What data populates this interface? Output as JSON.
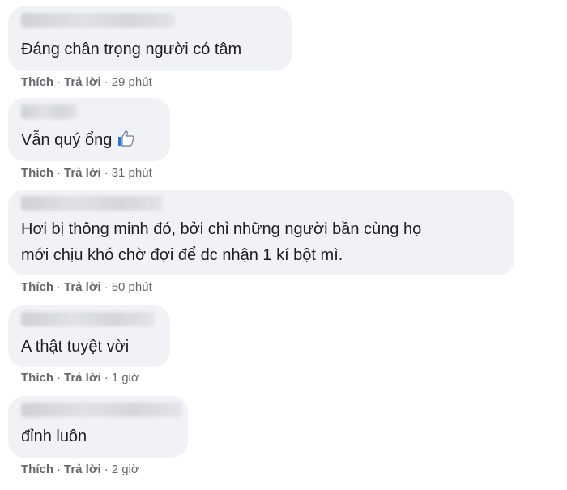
{
  "comments": [
    {
      "text": "Đáng chân trọng người có tâm",
      "like": "Thích",
      "reply": "Trả lời",
      "time": "29 phút"
    },
    {
      "text": "Vẫn quý ổng",
      "like": "Thích",
      "reply": "Trả lời",
      "time": "31 phút",
      "icon": "thumbs-up-icon"
    },
    {
      "text": "Hơi bị thông minh đó, bởi chỉ những người bần cùng họ",
      "text2": "mới chịu khó chờ đợi để dc nhận 1 kí bột mì.",
      "like": "Thích",
      "reply": "Trả lời",
      "time": "50 phút"
    },
    {
      "text": "A thật tuyệt vời",
      "like": "Thích",
      "reply": "Trả lời",
      "time": "1 giờ"
    },
    {
      "text": "đỉnh luôn",
      "like": "Thích",
      "reply": "Trả lời",
      "time": "2 giờ"
    }
  ],
  "colors": {
    "bubble": "#f0f2f5",
    "meta": "#65676b",
    "text": "#1c1e21",
    "like_icon": "#1877f2"
  }
}
